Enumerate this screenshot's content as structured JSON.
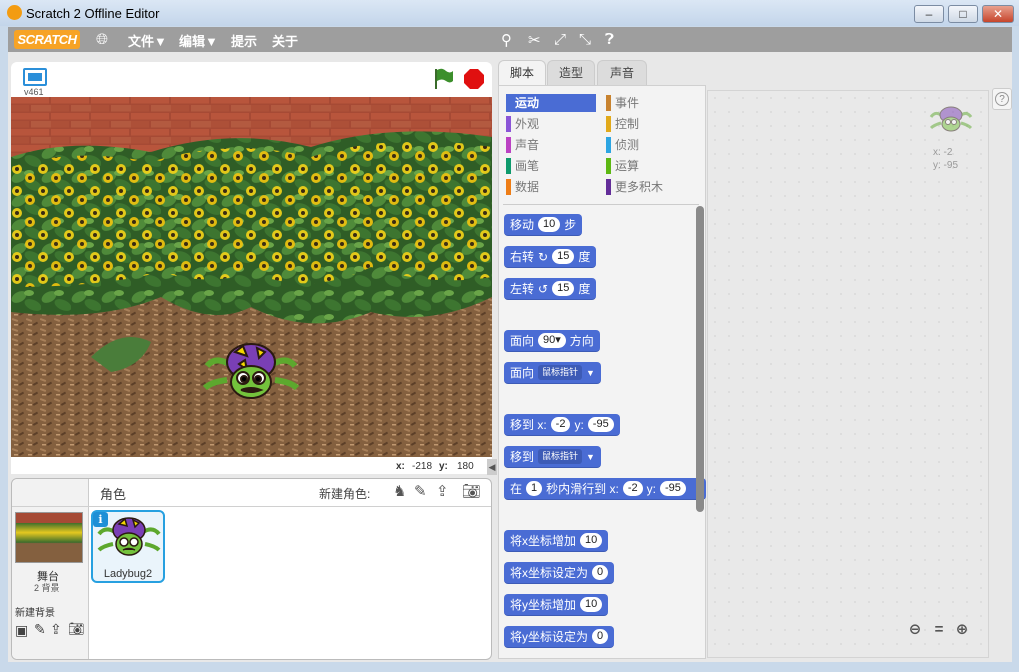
{
  "window": {
    "title": "Scratch 2 Offline Editor",
    "minimize": "–",
    "maximize": "□",
    "close": "✕"
  },
  "menu": {
    "logo": "SCRATCH",
    "items": [
      "文件▼",
      "编辑▼",
      "提示",
      "关于"
    ]
  },
  "stage": {
    "version": "v461",
    "mouse_x_label": "x:",
    "mouse_x": "-218",
    "mouse_y_label": "y:",
    "mouse_y": "180"
  },
  "sprites": {
    "header": "角色",
    "new_sprite": "新建角色:",
    "stage_label": "舞台",
    "stage_backdrops": "2 背景",
    "new_backdrop": "新建背景",
    "sprite_name": "Ladybug2"
  },
  "tabs": [
    "脚本",
    "造型",
    "声音"
  ],
  "categories_left": [
    "运动",
    "外观",
    "声音",
    "画笔",
    "数据"
  ],
  "categories_right": [
    "事件",
    "控制",
    "侦测",
    "运算",
    "更多积木"
  ],
  "colors": {
    "motion": "#4a6cd4",
    "looks": "#8a55d7",
    "sound": "#bb42c3",
    "pen": "#0e9a6c",
    "data": "#ee7d16",
    "events": "#c88330",
    "control": "#e1a91a",
    "sensing": "#2ca5e2",
    "operators": "#5cb712",
    "more": "#632d99"
  },
  "blocks": {
    "move": "移动",
    "move_val": "10",
    "move_unit": "步",
    "turn_r": "右转",
    "turn_r_val": "15",
    "turn_r_unit": "度",
    "turn_l": "左转",
    "turn_l_val": "15",
    "turn_l_unit": "度",
    "point_dir": "面向",
    "point_dir_val": "90▾",
    "point_dir_unit": "方向",
    "point_to": "面向",
    "point_to_val": "鼠标指针",
    "goto_xy": "移到 x:",
    "goto_x": "-2",
    "goto_y_lbl": "y:",
    "goto_y": "-95",
    "goto": "移到",
    "goto_val": "鼠标指针",
    "glide": "在",
    "glide_secs": "1",
    "glide_mid": "秒内滑行到 x:",
    "glide_x": "-2",
    "glide_y_lbl": "y:",
    "glide_y": "-95",
    "change_x": "将x坐标增加",
    "change_x_val": "10",
    "set_x": "将x坐标设定为",
    "set_x_val": "0",
    "change_y": "将y坐标增加",
    "change_y_val": "10",
    "set_y": "将y坐标设定为",
    "set_y_val": "0"
  },
  "script_area": {
    "sprite_x": "x: -2",
    "sprite_y": "y: -95",
    "zoom_out": "⊖",
    "zoom_reset": "=",
    "zoom_in": "⊕",
    "help": "?"
  }
}
